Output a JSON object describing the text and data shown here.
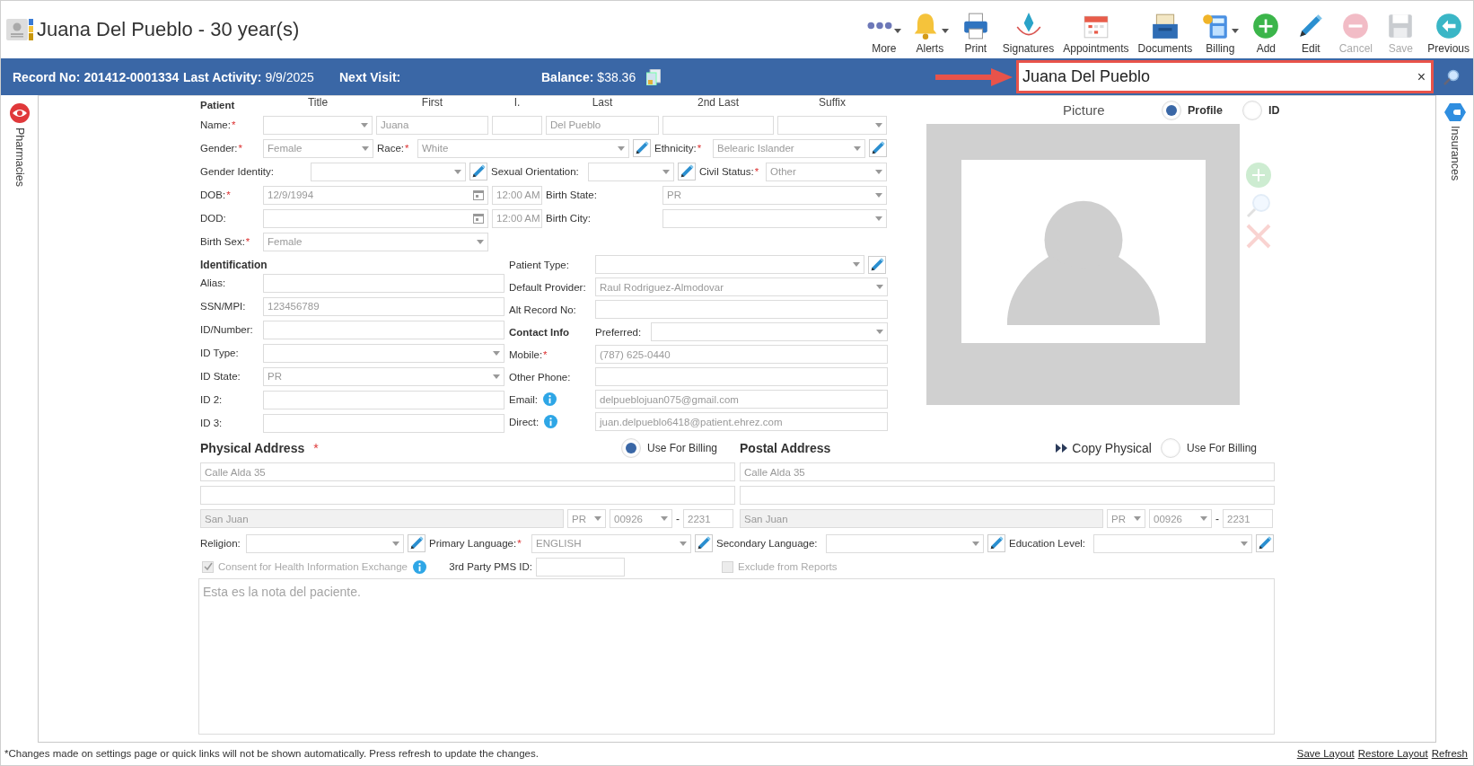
{
  "header": {
    "title": "Juana Del Pueblo - 30 year(s)"
  },
  "toolbar": [
    {
      "label": "More",
      "dropdown": true,
      "disabled": false
    },
    {
      "label": "Alerts",
      "dropdown": true,
      "disabled": false
    },
    {
      "label": "Print",
      "dropdown": false,
      "disabled": false
    },
    {
      "label": "Signatures",
      "dropdown": false,
      "disabled": false
    },
    {
      "label": "Appointments",
      "dropdown": false,
      "disabled": false
    },
    {
      "label": "Documents",
      "dropdown": false,
      "disabled": false
    },
    {
      "label": "Billing",
      "dropdown": true,
      "disabled": false
    },
    {
      "label": "Add",
      "dropdown": false,
      "disabled": false
    },
    {
      "label": "Edit",
      "dropdown": false,
      "disabled": false
    },
    {
      "label": "Cancel",
      "dropdown": false,
      "disabled": true
    },
    {
      "label": "Save",
      "dropdown": false,
      "disabled": true
    },
    {
      "label": "Previous",
      "dropdown": false,
      "disabled": false
    }
  ],
  "info_bar": {
    "items": [
      {
        "label": "Record No:",
        "value": "201412-0001334",
        "value_bold": true
      },
      {
        "label": "Last Activity:",
        "value": "9/9/2025",
        "value_bold": false
      },
      {
        "label": "Next Visit:"
      },
      {
        "label": "Balance:",
        "value": "$38.36",
        "value_bold": false
      }
    ],
    "search": {
      "value": "Juana Del Pueblo",
      "clear": "×",
      "highlighted": true
    }
  },
  "left_rail": {
    "label": "Pharmacies"
  },
  "right_rail": {
    "label": "Insurances"
  },
  "patient": {
    "heading": "Patient",
    "columns": [
      "Title",
      "First",
      "I.",
      "Last",
      "2nd Last",
      "Suffix"
    ],
    "rows": [
      [
        {
          "kind": "label",
          "text": "Name:",
          "required_mark": "*"
        },
        {
          "kind": "select"
        },
        {
          "kind": "input",
          "value": "Juana"
        },
        {
          "kind": "input"
        },
        {
          "kind": "input",
          "value": "Del Pueblo"
        },
        {
          "kind": "input"
        },
        {
          "kind": "select"
        }
      ],
      [
        {
          "kind": "label",
          "text": "Gender:",
          "required_mark": "*"
        },
        {
          "kind": "select",
          "value": "Female"
        },
        {
          "kind": "label",
          "text": "Race:",
          "required_mark": "*"
        },
        {
          "kind": "select",
          "value": "White"
        },
        {
          "kind": "edit"
        },
        {
          "kind": "label",
          "text": "Ethnicity:",
          "required_mark": "*"
        },
        {
          "kind": "select",
          "value": "Belearic Islander"
        },
        {
          "kind": "edit"
        }
      ],
      [
        {
          "kind": "label",
          "text": "Gender Identity:"
        },
        {
          "kind": "select"
        },
        {
          "kind": "edit"
        },
        {
          "kind": "label",
          "text": "Sexual Orientation:"
        },
        {
          "kind": "select"
        },
        {
          "kind": "edit"
        },
        {
          "kind": "label",
          "text": "Civil Status:",
          "required_mark": "*"
        },
        {
          "kind": "select",
          "value": "Other"
        }
      ],
      [
        {
          "kind": "label",
          "text": "DOB:",
          "required_mark": "*"
        },
        {
          "kind": "date",
          "value": "12/9/1994"
        },
        {
          "kind": "input",
          "value": "12:00 AM"
        },
        {
          "kind": "label",
          "text": "Birth State:"
        },
        {
          "kind": "select",
          "value": "PR"
        }
      ],
      [
        {
          "kind": "label",
          "text": "DOD:"
        },
        {
          "kind": "date"
        },
        {
          "kind": "input",
          "value": "12:00 AM"
        },
        {
          "kind": "label",
          "text": "Birth City:"
        },
        {
          "kind": "select"
        }
      ],
      [
        {
          "kind": "label",
          "text": "Birth Sex:",
          "required_mark": "*"
        },
        {
          "kind": "select",
          "value": "Female"
        }
      ]
    ]
  },
  "identification": {
    "heading": "Identification",
    "rows": [
      [
        {
          "kind": "label",
          "text": "Alias:"
        },
        {
          "kind": "input"
        }
      ],
      [
        {
          "kind": "label",
          "text": "SSN/MPI:"
        },
        {
          "kind": "input",
          "value": "123456789"
        }
      ],
      [
        {
          "kind": "label",
          "text": "ID/Number:"
        },
        {
          "kind": "input"
        }
      ],
      [
        {
          "kind": "label",
          "text": "ID Type:"
        },
        {
          "kind": "select"
        }
      ],
      [
        {
          "kind": "label",
          "text": "ID State:"
        },
        {
          "kind": "select",
          "value": "PR"
        }
      ],
      [
        {
          "kind": "label",
          "text": "ID 2:"
        },
        {
          "kind": "input"
        }
      ],
      [
        {
          "kind": "label",
          "text": "ID 3:"
        },
        {
          "kind": "input"
        }
      ]
    ]
  },
  "contact": {
    "rows": [
      [
        {
          "kind": "label",
          "text": "Patient Type:"
        },
        {
          "kind": "select"
        },
        {
          "kind": "edit"
        }
      ],
      [
        {
          "kind": "label",
          "text": "Default Provider:"
        },
        {
          "kind": "select",
          "value": "Raul Rodriguez-Almodovar"
        }
      ],
      [
        {
          "kind": "label",
          "text": "Alt Record No:"
        },
        {
          "kind": "input"
        }
      ],
      [
        {
          "kind": "heading",
          "text": "Contact Info"
        },
        {
          "kind": "label",
          "text": "Preferred:"
        },
        {
          "kind": "select"
        }
      ],
      [
        {
          "kind": "label",
          "text": "Mobile:",
          "required_mark": "*"
        },
        {
          "kind": "input",
          "value": "(787) 625-0440"
        }
      ],
      [
        {
          "kind": "label",
          "text": "Other Phone:"
        },
        {
          "kind": "input"
        }
      ],
      [
        {
          "kind": "label",
          "text": "Email:",
          "info": true
        },
        {
          "kind": "input",
          "value": "delpueblojuan075@gmail.com"
        }
      ],
      [
        {
          "kind": "label",
          "text": "Direct:",
          "info": true
        },
        {
          "kind": "input",
          "value": "juan.delpueblo6418@patient.ehrez.com"
        }
      ]
    ]
  },
  "picture": {
    "title": "Picture",
    "options": [
      {
        "label": "Profile",
        "selected": true
      },
      {
        "label": "ID",
        "selected": false
      }
    ],
    "actions": [
      {
        "disabled": true
      },
      {
        "disabled": true
      },
      {
        "disabled": true
      }
    ]
  },
  "addresses": [
    {
      "heading": "Physical Address",
      "required_mark": "*",
      "billing": {
        "label": "Use For Billing",
        "selected": true
      },
      "line1": "Calle Alda 35",
      "city": "San Juan",
      "state": "PR",
      "zip": "00926",
      "separator": "-",
      "zip4": "2231"
    },
    {
      "heading": "Postal Address",
      "copy": "Copy Physical",
      "billing": {
        "label": "Use For Billing",
        "selected": false
      },
      "line1": "Calle Alda 35",
      "city": "San Juan",
      "state": "PR",
      "zip": "00926",
      "separator": "-",
      "zip4": "2231"
    }
  ],
  "extra": {
    "row": [
      {
        "kind": "label",
        "text": "Religion:"
      },
      {
        "kind": "select"
      },
      {
        "kind": "edit"
      },
      {
        "kind": "label",
        "text": "Primary Language:",
        "required_mark": "*"
      },
      {
        "kind": "select",
        "value": "ENGLISH"
      },
      {
        "kind": "edit"
      },
      {
        "kind": "label",
        "text": "Secondary Language:"
      },
      {
        "kind": "select"
      },
      {
        "kind": "edit"
      },
      {
        "kind": "label",
        "text": "Education Level:"
      },
      {
        "kind": "select"
      },
      {
        "kind": "edit"
      }
    ],
    "consent": {
      "label": "Consent for Health Information Exchange",
      "checked": true,
      "disabled": true,
      "info": true
    },
    "pms": {
      "label": "3rd Party PMS ID:"
    },
    "exclude": {
      "label": "Exclude from Reports",
      "checked": false,
      "disabled": true
    }
  },
  "notes": {
    "value": "Esta es la nota del paciente."
  },
  "footer": {
    "note": "*Changes made on settings page or quick links will not be shown automatically. Press refresh to update the changes.",
    "links": [
      "Save Layout",
      "Restore Layout",
      "Refresh"
    ]
  }
}
